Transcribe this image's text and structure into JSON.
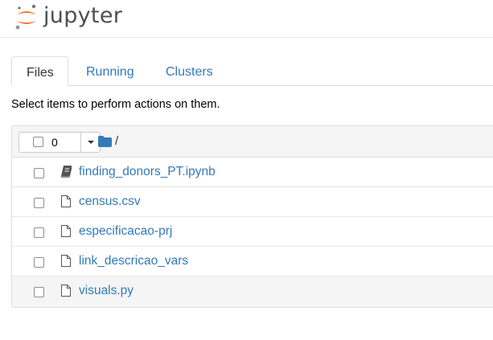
{
  "header": {
    "logo_text": "jupyter"
  },
  "tabs": [
    {
      "label": "Files",
      "active": true
    },
    {
      "label": "Running",
      "active": false
    },
    {
      "label": "Clusters",
      "active": false
    }
  ],
  "instructions": "Select items to perform actions on them.",
  "list": {
    "selected_count": "0",
    "breadcrumb": "/",
    "items": [
      {
        "name": "finding_donors_PT.ipynb",
        "icon": "notebook-icon"
      },
      {
        "name": "census.csv",
        "icon": "file-icon"
      },
      {
        "name": "especificacao-prj",
        "icon": "file-icon"
      },
      {
        "name": "link_descricao_vars",
        "icon": "file-icon"
      },
      {
        "name": "visuals.py",
        "icon": "file-icon"
      }
    ]
  },
  "colors": {
    "link": "#337ab7",
    "logo_orange": "#f37726",
    "header_bg": "#f5f5f5",
    "border": "#dddddd"
  }
}
